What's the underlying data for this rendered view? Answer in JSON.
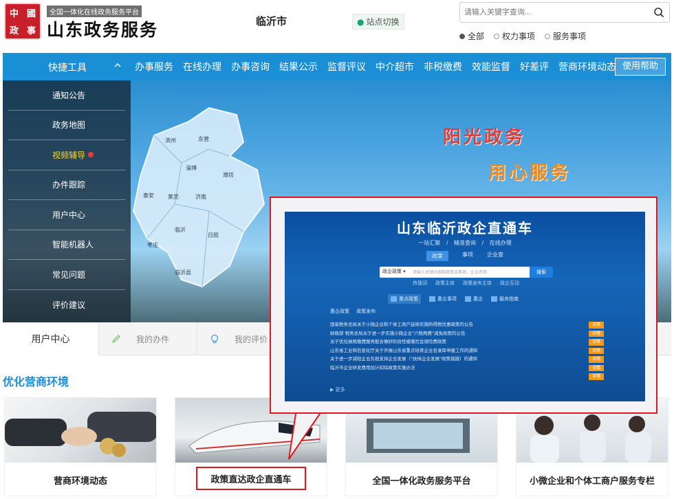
{
  "header": {
    "seal_text": [
      "中",
      "國",
      "政",
      "事"
    ],
    "top_banner": "全国一体化在线政务服务平台",
    "site_name": "山东政务服务",
    "city": "临沂市",
    "switch_label": "站点切换",
    "search_placeholder": "请输入关键字查询...",
    "radios": [
      {
        "label": "全部",
        "checked": true
      },
      {
        "label": "权力事项",
        "checked": false
      },
      {
        "label": "服务事项",
        "checked": false
      }
    ]
  },
  "nav": {
    "quick_tools": "快捷工具",
    "items": [
      "办事服务",
      "在线办理",
      "办事咨询",
      "结果公示",
      "监督评议",
      "中介超市",
      "非税缴费",
      "效能监督",
      "好差评",
      "营商环境动态"
    ],
    "help": "使用帮助"
  },
  "side_menu": [
    {
      "label": "通知公告"
    },
    {
      "label": "政务地图"
    },
    {
      "label": "视频辅导",
      "highlight": true
    },
    {
      "label": "办件跟踪"
    },
    {
      "label": "用户中心"
    },
    {
      "label": "智能机器人"
    },
    {
      "label": "常见问题"
    },
    {
      "label": "评价建议"
    }
  ],
  "hero": {
    "slogan1": "阳光政务",
    "slogan2": "用心服务",
    "map_labels": [
      "滨州",
      "东营",
      "淄博",
      "潍坊",
      "泰安",
      "莱芜",
      "济南",
      "临沂",
      "日照",
      "枣庄",
      "临沂县"
    ]
  },
  "tabs": {
    "user_center": "用户中心",
    "my_cases": "我的办件",
    "my_reviews": "我的评价"
  },
  "section_title": "优化营商环境",
  "cards": [
    {
      "caption": "营商环境动态"
    },
    {
      "caption": "政策直达政企直通车"
    },
    {
      "caption": "全国一体化政务服务平台"
    },
    {
      "caption": "小微企业和个体工商户服务专栏"
    }
  ],
  "callout": {
    "title": "山东临沂政企直通车",
    "subtitle": "一站汇聚 / 精准查询 / 在线办理",
    "tabs": [
      "政策",
      "事项",
      "企业查"
    ],
    "search_select": "政企政策",
    "search_placeholder": "请输入关键词搜索政策或事项、企业名称",
    "search_button": "搜索",
    "links": [
      "热搜词",
      "政策主体",
      "政策发布主体",
      "政企互动"
    ],
    "categories": [
      "重点政策",
      "惠企事项",
      "惠企",
      "服务指南"
    ],
    "sub_tabs": "惠企政策  政策发布",
    "rows": [
      "国家税务总局关于小微企业和个体工商户延续实施所得税优惠政策的公告",
      "财政部 税务总局关于进一步实施小微企业\"六税两费\"减免政策的公告",
      "关于优化纳税缴费服务配合做好阶段性缓缴社会保险费政策",
      "山东省工业和信息化厅关于开展山东省重点培育企业名录库申报工作的通知",
      "关于进一步减轻企业负担支持企业发展（\"扶持企业发展\"政策措施）的通知",
      "临沂市企业研发费用加计扣除政策实施办法"
    ],
    "row_button": "详情",
    "more": "更多"
  }
}
